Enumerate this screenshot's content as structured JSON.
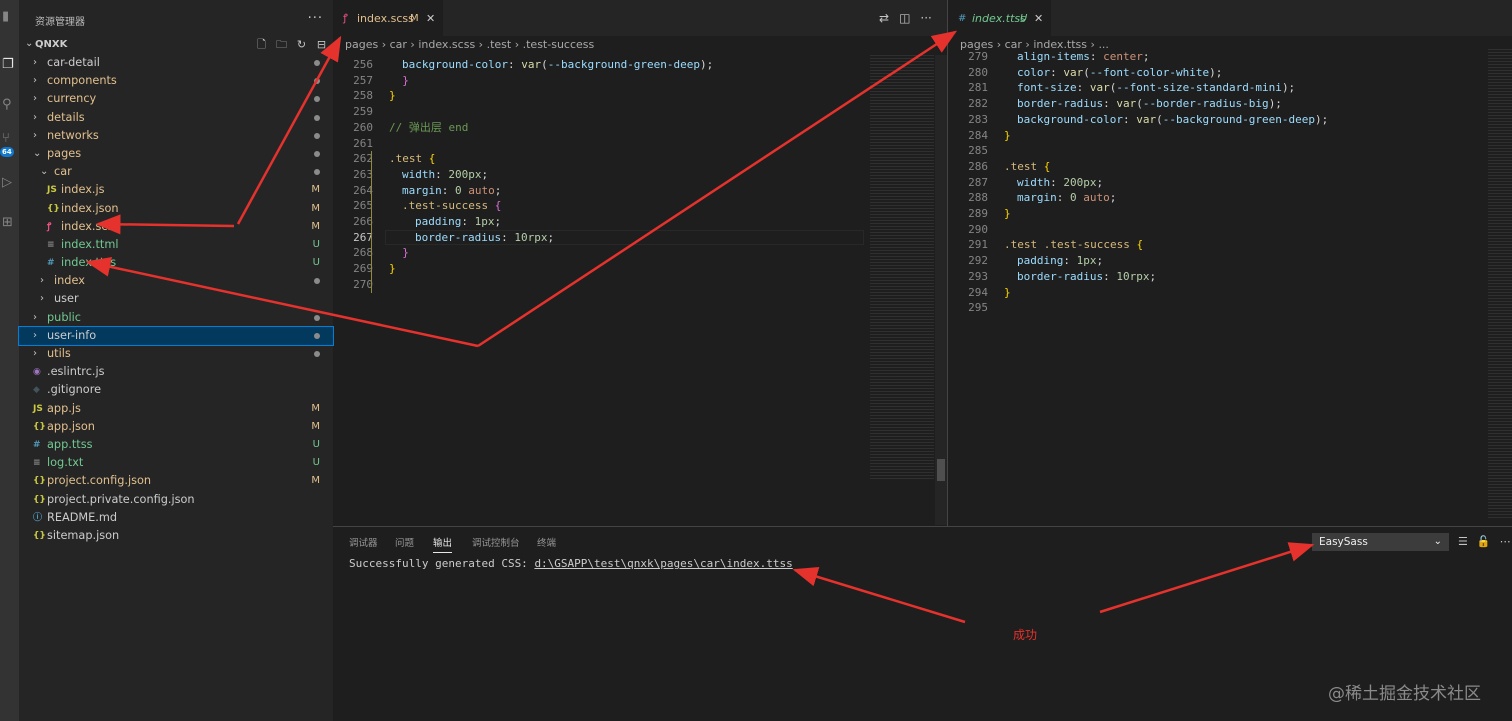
{
  "colors": {
    "accent": "#007fd4",
    "modified": "#e2c08d",
    "untracked": "#73c991",
    "annotation": "#e5322d"
  },
  "activity_icons": [
    "files-icon",
    "search-icon",
    "source-control-icon",
    "run-debug-icon",
    "extensions-icon"
  ],
  "activity_badge": "64",
  "sidebar": {
    "title": "资源管理器",
    "root": "QNXK",
    "items": [
      {
        "name": "car-detail",
        "kind": "folder",
        "indent": 0,
        "open": false,
        "mark": "dot",
        "color": "def"
      },
      {
        "name": "components",
        "kind": "folder",
        "indent": 0,
        "open": false,
        "mark": "dot",
        "color": "mod"
      },
      {
        "name": "currency",
        "kind": "folder",
        "indent": 0,
        "open": false,
        "mark": "dot",
        "color": "mod"
      },
      {
        "name": "details",
        "kind": "folder",
        "indent": 0,
        "open": false,
        "mark": "dot",
        "color": "mod"
      },
      {
        "name": "networks",
        "kind": "folder",
        "indent": 0,
        "open": false,
        "mark": "dot",
        "color": "mod"
      },
      {
        "name": "pages",
        "kind": "folder",
        "indent": 0,
        "open": true,
        "mark": "dot",
        "color": "mod"
      },
      {
        "name": "car",
        "kind": "folder",
        "indent": 1,
        "open": true,
        "mark": "dot",
        "color": "mod"
      },
      {
        "name": "index.js",
        "kind": "js",
        "indent": 2,
        "mark": "M",
        "color": "mod"
      },
      {
        "name": "index.json",
        "kind": "json",
        "indent": 2,
        "mark": "M",
        "color": "mod"
      },
      {
        "name": "index.scss",
        "kind": "scss",
        "indent": 2,
        "mark": "M",
        "color": "mod"
      },
      {
        "name": "index.ttml",
        "kind": "ttml",
        "indent": 2,
        "mark": "U",
        "color": "new"
      },
      {
        "name": "index.ttss",
        "kind": "css",
        "indent": 2,
        "mark": "U",
        "color": "new"
      },
      {
        "name": "index",
        "kind": "folder",
        "indent": 1,
        "open": false,
        "mark": "dot",
        "color": "mod"
      },
      {
        "name": "user",
        "kind": "folder",
        "indent": 1,
        "open": false,
        "mark": "",
        "color": "def"
      },
      {
        "name": "public",
        "kind": "folder",
        "indent": 0,
        "open": false,
        "mark": "dot",
        "color": "new"
      },
      {
        "name": "user-info",
        "kind": "folder",
        "indent": 0,
        "open": false,
        "mark": "dot",
        "color": "def",
        "selected": true
      },
      {
        "name": "utils",
        "kind": "folder",
        "indent": 0,
        "open": false,
        "mark": "dot",
        "color": "mod"
      },
      {
        "name": ".eslintrc.js",
        "kind": "eslint",
        "indent": 0,
        "mark": "",
        "color": "def"
      },
      {
        "name": ".gitignore",
        "kind": "git",
        "indent": 0,
        "mark": "",
        "color": "def"
      },
      {
        "name": "app.js",
        "kind": "js",
        "indent": 0,
        "mark": "M",
        "color": "mod"
      },
      {
        "name": "app.json",
        "kind": "json",
        "indent": 0,
        "mark": "M",
        "color": "mod"
      },
      {
        "name": "app.ttss",
        "kind": "css",
        "indent": 0,
        "mark": "U",
        "color": "new"
      },
      {
        "name": "log.txt",
        "kind": "ttml",
        "indent": 0,
        "mark": "U",
        "color": "new"
      },
      {
        "name": "project.config.json",
        "kind": "json",
        "indent": 0,
        "mark": "M",
        "color": "mod"
      },
      {
        "name": "project.private.config.json",
        "kind": "json",
        "indent": 0,
        "mark": "",
        "color": "def"
      },
      {
        "name": "README.md",
        "kind": "info",
        "indent": 0,
        "mark": "",
        "color": "def"
      },
      {
        "name": "sitemap.json",
        "kind": "json",
        "indent": 0,
        "mark": "",
        "color": "def"
      }
    ]
  },
  "left_editor": {
    "tab": {
      "icon": "sass-icon",
      "label": "index.scss",
      "status": "M"
    },
    "breadcrumb": [
      "pages",
      "car",
      "index.scss",
      ".test",
      ".test-success"
    ],
    "current_line": "267",
    "lines": [
      {
        "n": "256",
        "indent": 1,
        "tokens": [
          [
            "prop",
            "background-color"
          ],
          [
            "def",
            ": "
          ],
          [
            "fn",
            "var"
          ],
          [
            "def",
            "("
          ],
          [
            "var",
            "--background-green-deep"
          ],
          [
            "def",
            ");"
          ]
        ]
      },
      {
        "n": "257",
        "indent": 0,
        "tokens": [
          [
            "br2",
            "  }"
          ]
        ]
      },
      {
        "n": "258",
        "indent": 0,
        "tokens": [
          [
            "br",
            "}"
          ]
        ]
      },
      {
        "n": "259",
        "indent": 0,
        "tokens": []
      },
      {
        "n": "260",
        "indent": 0,
        "tokens": [
          [
            "cm",
            "// 弹出层 end"
          ]
        ]
      },
      {
        "n": "261",
        "indent": 0,
        "tokens": []
      },
      {
        "n": "262",
        "indent": 0,
        "tokens": [
          [
            "sel",
            ".test"
          ],
          [
            "def",
            " "
          ],
          [
            "br",
            "{"
          ]
        ]
      },
      {
        "n": "263",
        "indent": 1,
        "tokens": [
          [
            "prop",
            "width"
          ],
          [
            "def",
            ": "
          ],
          [
            "num",
            "200px"
          ],
          [
            "def",
            ";"
          ]
        ]
      },
      {
        "n": "264",
        "indent": 1,
        "tokens": [
          [
            "prop",
            "margin"
          ],
          [
            "def",
            ": "
          ],
          [
            "num",
            "0"
          ],
          [
            "def",
            " "
          ],
          [
            "kw",
            "auto"
          ],
          [
            "def",
            ";"
          ]
        ]
      },
      {
        "n": "265",
        "indent": 1,
        "tokens": [
          [
            "sel",
            ".test-success"
          ],
          [
            "def",
            " "
          ],
          [
            "br2",
            "{"
          ]
        ]
      },
      {
        "n": "266",
        "indent": 2,
        "tokens": [
          [
            "prop",
            "padding"
          ],
          [
            "def",
            ": "
          ],
          [
            "num",
            "1px"
          ],
          [
            "def",
            ";"
          ]
        ]
      },
      {
        "n": "267",
        "indent": 2,
        "tokens": [
          [
            "prop",
            "border-radius"
          ],
          [
            "def",
            ": "
          ],
          [
            "num",
            "10rpx"
          ],
          [
            "def",
            ";"
          ]
        ]
      },
      {
        "n": "268",
        "indent": 0,
        "tokens": [
          [
            "br2",
            "  }"
          ]
        ]
      },
      {
        "n": "269",
        "indent": 0,
        "tokens": [
          [
            "br",
            "}"
          ]
        ]
      },
      {
        "n": "270",
        "indent": 0,
        "tokens": []
      }
    ]
  },
  "right_editor": {
    "tab": {
      "icon": "css-icon",
      "label": "index.ttss",
      "status": "U"
    },
    "breadcrumb": [
      "pages",
      "car",
      "index.ttss",
      "..."
    ],
    "lines": [
      {
        "n": "279",
        "indent": 1,
        "tokens": [
          [
            "prop",
            "align-items"
          ],
          [
            "def",
            ": "
          ],
          [
            "kw",
            "center"
          ],
          [
            "def",
            ";"
          ]
        ]
      },
      {
        "n": "280",
        "indent": 1,
        "tokens": [
          [
            "prop",
            "color"
          ],
          [
            "def",
            ": "
          ],
          [
            "fn",
            "var"
          ],
          [
            "def",
            "("
          ],
          [
            "var",
            "--font-color-white"
          ],
          [
            "def",
            ");"
          ]
        ]
      },
      {
        "n": "281",
        "indent": 1,
        "tokens": [
          [
            "prop",
            "font-size"
          ],
          [
            "def",
            ": "
          ],
          [
            "fn",
            "var"
          ],
          [
            "def",
            "("
          ],
          [
            "var",
            "--font-size-standard-mini"
          ],
          [
            "def",
            ");"
          ]
        ]
      },
      {
        "n": "282",
        "indent": 1,
        "tokens": [
          [
            "prop",
            "border-radius"
          ],
          [
            "def",
            ": "
          ],
          [
            "fn",
            "var"
          ],
          [
            "def",
            "("
          ],
          [
            "var",
            "--border-radius-big"
          ],
          [
            "def",
            ");"
          ]
        ]
      },
      {
        "n": "283",
        "indent": 1,
        "tokens": [
          [
            "prop",
            "background-color"
          ],
          [
            "def",
            ": "
          ],
          [
            "fn",
            "var"
          ],
          [
            "def",
            "("
          ],
          [
            "var",
            "--background-green-deep"
          ],
          [
            "def",
            ");"
          ]
        ]
      },
      {
        "n": "284",
        "indent": 0,
        "tokens": [
          [
            "br",
            "}"
          ]
        ]
      },
      {
        "n": "285",
        "indent": 0,
        "tokens": []
      },
      {
        "n": "286",
        "indent": 0,
        "tokens": [
          [
            "sel",
            ".test"
          ],
          [
            "def",
            " "
          ],
          [
            "br",
            "{"
          ]
        ]
      },
      {
        "n": "287",
        "indent": 1,
        "tokens": [
          [
            "prop",
            "width"
          ],
          [
            "def",
            ": "
          ],
          [
            "num",
            "200px"
          ],
          [
            "def",
            ";"
          ]
        ]
      },
      {
        "n": "288",
        "indent": 1,
        "tokens": [
          [
            "prop",
            "margin"
          ],
          [
            "def",
            ": "
          ],
          [
            "num",
            "0"
          ],
          [
            "def",
            " "
          ],
          [
            "kw",
            "auto"
          ],
          [
            "def",
            ";"
          ]
        ]
      },
      {
        "n": "289",
        "indent": 0,
        "tokens": [
          [
            "br",
            "}"
          ]
        ]
      },
      {
        "n": "290",
        "indent": 0,
        "tokens": []
      },
      {
        "n": "291",
        "indent": 0,
        "tokens": [
          [
            "sel",
            ".test .test-success"
          ],
          [
            "def",
            " "
          ],
          [
            "br",
            "{"
          ]
        ]
      },
      {
        "n": "292",
        "indent": 1,
        "tokens": [
          [
            "prop",
            "padding"
          ],
          [
            "def",
            ": "
          ],
          [
            "num",
            "1px"
          ],
          [
            "def",
            ";"
          ]
        ]
      },
      {
        "n": "293",
        "indent": 1,
        "tokens": [
          [
            "prop",
            "border-radius"
          ],
          [
            "def",
            ": "
          ],
          [
            "num",
            "10rpx"
          ],
          [
            "def",
            ";"
          ]
        ]
      },
      {
        "n": "294",
        "indent": 0,
        "tokens": [
          [
            "br",
            "}"
          ]
        ]
      },
      {
        "n": "295",
        "indent": 0,
        "tokens": []
      }
    ]
  },
  "panel": {
    "tabs": [
      "调试器",
      "问题",
      "输出",
      "调试控制台",
      "终端"
    ],
    "active_tab": "输出",
    "output_prefix": "Successfully generated CSS: ",
    "output_path": "d:\\GSAPP\\test\\qnxk\\pages\\car\\index.ttss",
    "channel": "EasySass"
  },
  "annotation": "成功",
  "watermark": "@稀土掘金技术社区"
}
